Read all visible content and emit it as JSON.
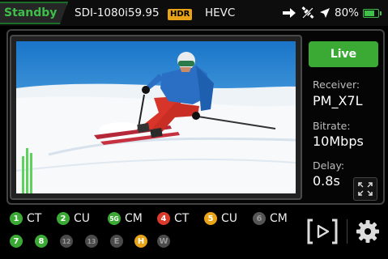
{
  "status_bar": {
    "mode": "Standby",
    "video_format": "SDI-1080i59.95",
    "hdr_badge": "HDR",
    "codec": "HEVC",
    "battery_percent": "80%",
    "battery_level": 0.8,
    "icons": [
      "export-arrow-icon",
      "gps-off-icon",
      "location-arrow-icon",
      "battery-icon"
    ]
  },
  "live_button": {
    "label": "Live",
    "color": "#3aaa35"
  },
  "info": {
    "receiver_label": "Receiver:",
    "receiver_value": "PM_X7L",
    "bitrate_label": "Bitrate:",
    "bitrate_value": "10Mbps",
    "delay_label": "Delay:",
    "delay_value": "0.8s"
  },
  "links": [
    {
      "badge": "1",
      "label": "CT",
      "color": "#3aaa35"
    },
    {
      "badge": "2",
      "label": "CU",
      "color": "#3aaa35"
    },
    {
      "badge": "5G",
      "label": "CM",
      "color": "#3aaa35"
    },
    {
      "badge": "4",
      "label": "CT",
      "color": "#d93a2b"
    },
    {
      "badge": "5",
      "label": "CU",
      "color": "#e8a317"
    },
    {
      "badge": "6",
      "label": "CM",
      "color": "#555555"
    },
    {
      "badge": "7",
      "label": "",
      "color": "#3aaa35"
    },
    {
      "badge": "8",
      "label": "",
      "color": "#3aaa35"
    },
    {
      "badge": "12",
      "label": "",
      "color": "#4a4a4a"
    },
    {
      "badge": "13",
      "label": "",
      "color": "#4a4a4a"
    },
    {
      "badge": "E",
      "label": "",
      "color": "#4a4a4a"
    },
    {
      "badge": "H",
      "label": "",
      "color": "#e8a317"
    },
    {
      "badge": "W",
      "label": "",
      "color": "#4a4a4a"
    }
  ],
  "colors": {
    "accent_green": "#3aaa35",
    "standby_green": "#3fbf4a"
  }
}
